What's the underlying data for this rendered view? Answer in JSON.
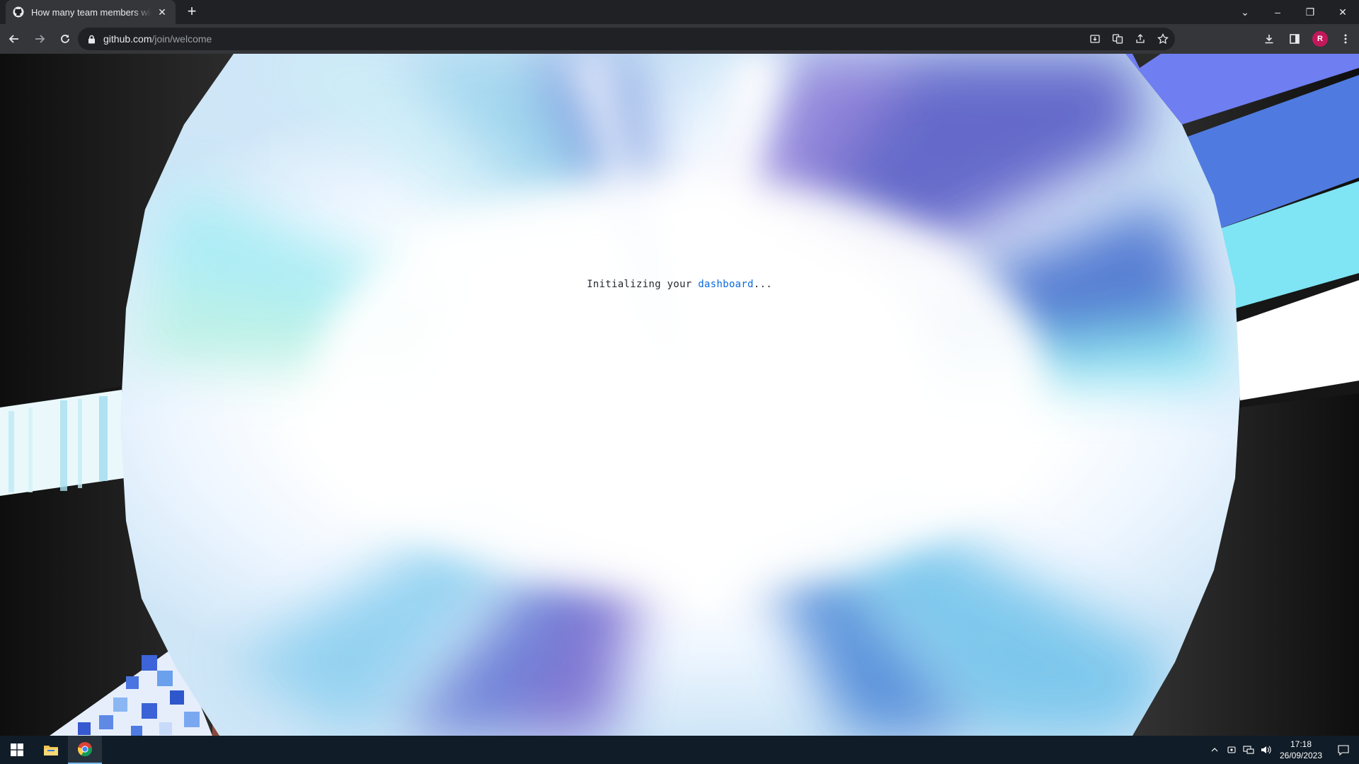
{
  "browser": {
    "tab_title": "How many team members will be",
    "tab_close": "✕",
    "new_tab": "+",
    "url_host": "github.com",
    "url_path": "/join/welcome",
    "profile_initial": "R"
  },
  "window_controls": {
    "chevron": "⌄",
    "minimize": "–",
    "restore": "❐",
    "close": "✕"
  },
  "page": {
    "loading_prefix": "Initializing your ",
    "loading_link": "dashboard",
    "loading_suffix": "..."
  },
  "taskbar": {
    "time": "17:18",
    "date": "26/09/2023",
    "apps": [
      "start",
      "file-explorer",
      "chrome"
    ]
  },
  "colors": {
    "accent_link": "#0969da",
    "profile_avatar": "#c2185b",
    "taskbar": "#101c27"
  }
}
